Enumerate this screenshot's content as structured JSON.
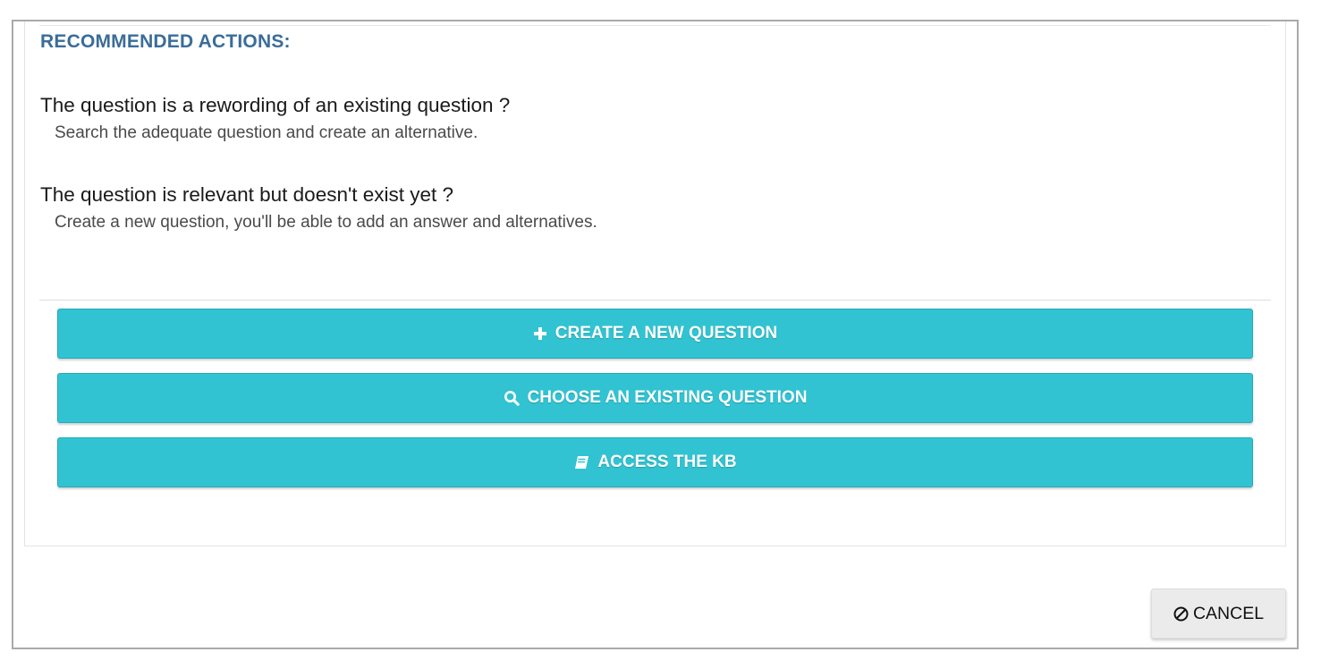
{
  "recommended": {
    "title": "RECOMMENDED ACTIONS:",
    "items": [
      {
        "question": "The question is a rewording of an existing question ?",
        "hint": "Search the adequate question and create an alternative."
      },
      {
        "question": "The question is relevant but doesn't exist yet ?",
        "hint": "Create a new question, you'll be able to add an answer and alternatives."
      }
    ]
  },
  "actions": [
    {
      "label": "CREATE A NEW QUESTION",
      "icon": "plus-icon"
    },
    {
      "label": "CHOOSE AN EXISTING QUESTION",
      "icon": "search-icon"
    },
    {
      "label": "ACCESS THE KB",
      "icon": "book-icon"
    }
  ],
  "footer": {
    "cancel_label": "CANCEL",
    "cancel_icon": "ban-icon"
  },
  "colors": {
    "accent": "#31c3d2",
    "title": "#3a6d99",
    "cancel_bg": "#ebebeb"
  }
}
